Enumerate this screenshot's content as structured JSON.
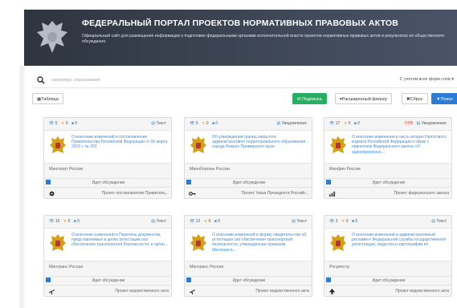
{
  "header": {
    "title": "ФЕДЕРАЛЬНЫЙ ПОРТАЛ ПРОЕКТОВ НОРМАТИВНЫХ ПРАВОВЫХ АКТОВ",
    "subtitle": "Официальный сайт для размещения информации о подготовке федеральными органами исполнительной власти проектов нормативных правовых актов и результатах их общественного обсуждения"
  },
  "search": {
    "placeholder": "например: образование",
    "morphology": "С учетом всех форм слов"
  },
  "toolbar": {
    "table_label": "Таблица",
    "subscribe_label": "Подписка",
    "advanced_label": "Расширенный фильтр",
    "reset_label": "Сброс",
    "find_label": "Поиск"
  },
  "cards": [
    {
      "views": "5",
      "stars": "0",
      "comments": "0",
      "ofv": "",
      "type": "Текст",
      "description": "О внесении изменений в постановление Правительства Российской Федерации от 06 марта 2015 г. № 202",
      "agency": "Минспорт России",
      "status": "Идет обсуждение",
      "act_type": "Проект постановления Правитель..."
    },
    {
      "views": "0",
      "stars": "0",
      "comments": "0",
      "ofv": "",
      "type": "Уведомление",
      "description": "Об утверждении границ закрытого административно-территориального образования - города Фокино Приморского края",
      "agency": "Минобороны России",
      "status": "Идет обсуждение",
      "act_type": "Проект Указа Президента Российс..."
    },
    {
      "views": "17",
      "stars": "0",
      "comments": "0",
      "ofv": "ОРВ",
      "type": "Уведомление",
      "description": "О внесении изменения в часть вторую Налогового кодекса Российской Федерации в связи с принятием Федерального закона «О единовременно...",
      "agency": "Минфин России",
      "status": "Идет обсуждение",
      "act_type": "Проект федерального закона"
    },
    {
      "views": "15",
      "stars": "0",
      "comments": "0",
      "ofv": "",
      "type": "Текст",
      "description": "О внесении изменений в Перечень документов, представляемых в целях аттестации сил обеспечения транспортной безопасности, в орган...",
      "agency": "Минтранс России",
      "status": "Идет обсуждение",
      "act_type": "Проект ведомственного акта"
    },
    {
      "views": "12",
      "stars": "0",
      "comments": "0",
      "ofv": "",
      "type": "Текст",
      "description": "О внесении изменений в форму свидетельства об аттестации сил обеспечения транспортной безопасности, утвержденную приказом Минтранса...",
      "agency": "Минтранс России",
      "status": "Идет обсуждение",
      "act_type": "Проект ведомственного акта"
    },
    {
      "views": "3",
      "stars": "0",
      "comments": "0",
      "ofv": "",
      "type": "Текст",
      "description": "О внесении изменений в административный регламент Федеральной службы государственной регистрации, кадастра и картографии по",
      "agency": "Росреестр",
      "status": "Идет обсуждение",
      "act_type": "Проект ведомственного акта"
    }
  ],
  "colors": {
    "header_dark": "#2e3440",
    "accent_blue": "#2b7bd8",
    "accent_green": "#27ae60",
    "star": "#f0ad4e"
  },
  "icons": {
    "card_footer": [
      "gear-icon",
      "key-icon",
      "chart-icon",
      "plane-icon",
      "plane-icon",
      "up-arrow-icon"
    ]
  }
}
